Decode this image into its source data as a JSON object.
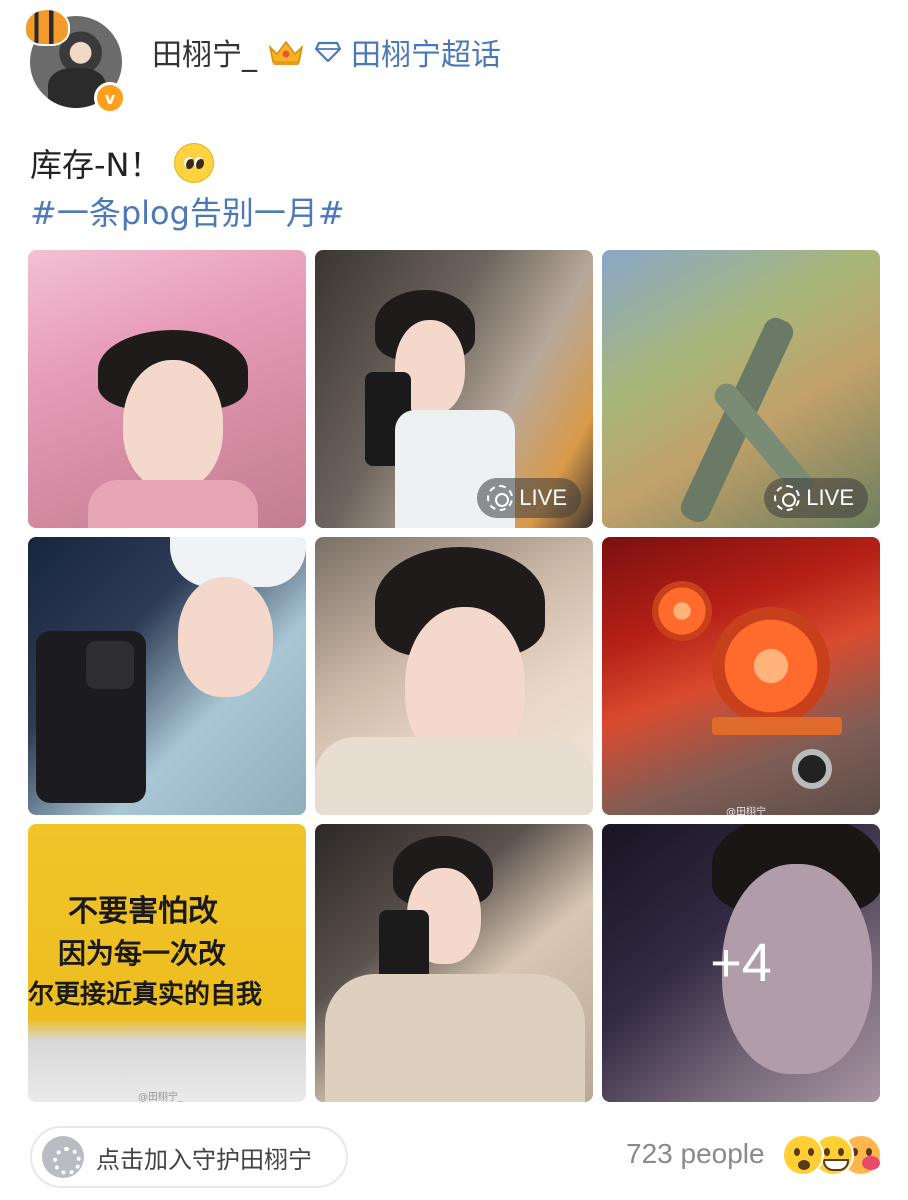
{
  "header": {
    "username": "田栩宁_",
    "supertopic_label": "田栩宁超话",
    "verified_symbol": "v",
    "icons": {
      "avatar_decoration": "tiger-icon",
      "level_badge": "crown-icon",
      "supertopic": "diamond-icon",
      "verified": "verified-icon"
    }
  },
  "post": {
    "text": "库存-N！",
    "emoji": "pleading-face-icon",
    "hashtag": "#一条plog告别一月#"
  },
  "images": [
    {
      "label": "",
      "live": false
    },
    {
      "label": "LIVE",
      "live": true
    },
    {
      "label": "LIVE",
      "live": true
    },
    {
      "label": "",
      "live": false
    },
    {
      "label": "",
      "live": false
    },
    {
      "label": "",
      "live": false,
      "watermark": "@田栩宁_"
    },
    {
      "label": "",
      "live": false,
      "watermark": "@田栩宁_",
      "sign_lines": [
        "不要害怕改",
        "因为每一次改",
        "尔更接近真实的自我"
      ]
    },
    {
      "label": "",
      "live": false
    },
    {
      "label": "",
      "live": false,
      "more_count": "+4"
    }
  ],
  "footer": {
    "join_label": "点击加入守护田栩宁",
    "people_count": "723 people",
    "reactions": [
      "surprised-face-icon",
      "grinning-face-icon",
      "kissing-face-icon"
    ]
  },
  "colors": {
    "link_blue": "#4b79b8",
    "badge_orange": "#ff9f1c"
  }
}
